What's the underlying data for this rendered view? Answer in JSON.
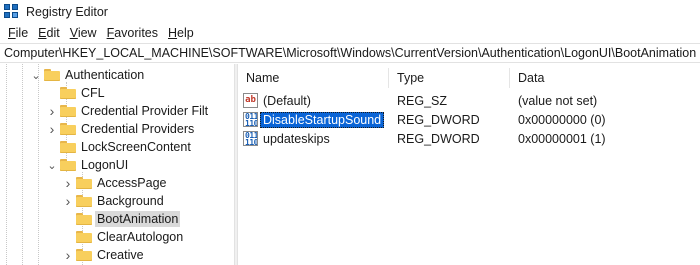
{
  "window": {
    "title": "Registry Editor",
    "icon": "registry-icon"
  },
  "menu": [
    {
      "acc": "F",
      "rest": "ile"
    },
    {
      "acc": "E",
      "rest": "dit"
    },
    {
      "acc": "V",
      "rest": "iew"
    },
    {
      "acc": "F",
      "rest": "avorites"
    },
    {
      "acc": "H",
      "rest": "elp"
    }
  ],
  "address": "Computer\\HKEY_LOCAL_MACHINE\\SOFTWARE\\Microsoft\\Windows\\CurrentVersion\\Authentication\\LogonUI\\BootAnimation",
  "tree": [
    {
      "label": "Authentication",
      "chevron": "expanded"
    },
    {
      "label": "CFL",
      "chevron": "none"
    },
    {
      "label": "Credential Provider Filt",
      "chevron": "collapsed"
    },
    {
      "label": "Credential Providers",
      "chevron": "collapsed"
    },
    {
      "label": "LockScreenContent",
      "chevron": "none"
    },
    {
      "label": "LogonUI",
      "chevron": "expanded"
    },
    {
      "label": "AccessPage",
      "chevron": "collapsed"
    },
    {
      "label": "Background",
      "chevron": "collapsed"
    },
    {
      "label": "BootAnimation",
      "chevron": "none",
      "selected": true
    },
    {
      "label": "ClearAutologon",
      "chevron": "none"
    },
    {
      "label": "Creative",
      "chevron": "collapsed"
    }
  ],
  "list": {
    "columns": [
      "Name",
      "Type",
      "Data"
    ],
    "rows": [
      {
        "icon": "string-value-icon",
        "icon_text": "ab",
        "name": "(Default)",
        "type": "REG_SZ",
        "data": "(value not set)",
        "selected": false
      },
      {
        "icon": "binary-value-icon",
        "icon_text": "011\n110",
        "name": "DisableStartupSound",
        "type": "REG_DWORD",
        "data": "0x00000000 (0)",
        "selected": true
      },
      {
        "icon": "binary-value-icon",
        "icon_text": "011\n110",
        "name": "updateskips",
        "type": "REG_DWORD",
        "data": "0x00000001 (1)",
        "selected": false
      }
    ]
  },
  "colors": {
    "selection": "#0a64d6",
    "tree_selection": "#d9d9d9",
    "folder": "#f8cf5d"
  }
}
